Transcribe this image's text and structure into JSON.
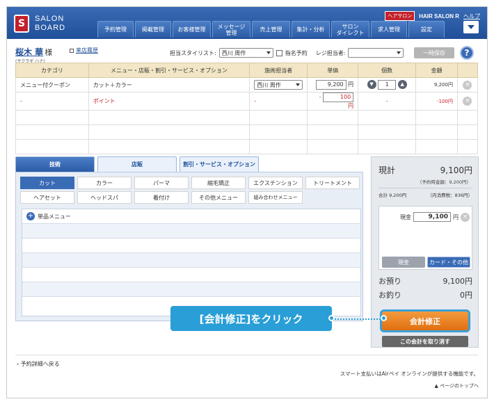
{
  "header": {
    "logo_mark": "S",
    "logo_line1": "SALON",
    "logo_line2": "BOARD",
    "hp_badge": "ヘアサロン",
    "salon_name": "HAIR SALON R",
    "help": "ヘルプ",
    "nav": [
      "予約管理",
      "掲載管理",
      "お客様管理",
      "メッセージ\n管理",
      "売上管理",
      "集計・分析",
      "サロン\nダイレクト",
      "求人管理",
      "設定"
    ]
  },
  "customer": {
    "name": "桜木 華",
    "honorific": "様",
    "kana": "(サクラギ ハナ)",
    "visit_history": "来店履歴",
    "stylist_label": "担当スタイリスト:",
    "stylist_value": "西川 周作",
    "designated_label": "指名予約",
    "register_label": "レジ担当者:",
    "register_value": "",
    "save_label": "一時保存",
    "help_icon": "?"
  },
  "table": {
    "headers": [
      "カテゴリ",
      "メニュー・店販・割引・サービス・オプション",
      "施術担当者",
      "単価",
      "個数",
      "金額"
    ],
    "rows": [
      {
        "category": "メニュー付クーポン",
        "menu": "カット＋カラー",
        "staff": "西川 周作",
        "price": "9,200",
        "yen": "円",
        "qty": "1",
        "amount": "9,200円"
      },
      {
        "category": "-",
        "menu": "ポイント",
        "staff": "-",
        "price_prefix": "-",
        "price": "100",
        "yen": "円",
        "qty": "-",
        "amount": "-100円"
      }
    ]
  },
  "tabs": [
    "技術",
    "店販",
    "割引・サービス・オプション"
  ],
  "categories": [
    "カット",
    "カラー",
    "パーマ",
    "縮毛矯正",
    "エクステンション",
    "トリートメント",
    "ヘアセット",
    "ヘッドスパ",
    "着付け",
    "その他メニュー",
    "組み合わせメニュー"
  ],
  "single_menu": "単品メニュー",
  "register": {
    "total_label": "現計",
    "total_value": "9,100円",
    "sub_note": "（予約時金額：9,200円）",
    "subtotal_label": "合計 9,200円",
    "tax_note": "（内消費税：836円）",
    "cash_label": "現金",
    "cash_value": "9,100",
    "yen": "円",
    "btn_cash": "現金",
    "btn_card": "カード・その他",
    "deposit_label": "お預り",
    "deposit_value": "9,100円",
    "change_label": "お釣り",
    "change_value": "0円",
    "fix_btn": "会計修正",
    "cancel_btn": "この会計を取り消す"
  },
  "callout": "[会計修正]をクリック",
  "footer": {
    "back": "予約詳細へ戻る",
    "note": "スマート支払いはAirペイ オンラインが提供する機能です。",
    "pagetop": "ページのトップへ"
  }
}
